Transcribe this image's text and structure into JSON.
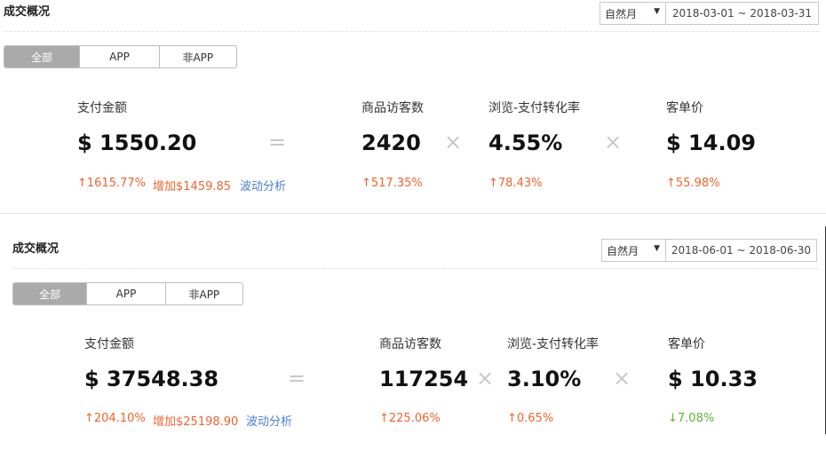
{
  "colors": {
    "increase": "#f0642a",
    "decrease": "#5cb531",
    "link": "#4a7fd3",
    "active_tab": "#aaaaaa"
  },
  "panels": [
    {
      "title": "成交概况",
      "period_select": "自然月",
      "date_range": "2018-03-01 ~ 2018-03-31",
      "tabs": [
        "全部",
        "APP",
        "非APP"
      ],
      "active_tab": "全部",
      "operators": {
        "equals": "=",
        "times": "×"
      },
      "metrics": {
        "pay_amount": {
          "label": "支付金额",
          "value": "$ 1550.20",
          "change": "↑1615.77%",
          "increase_text": "增加$1459.85",
          "analysis_link": "波动分析"
        },
        "visitors": {
          "label": "商品访客数",
          "value": "2420",
          "change": "↑517.35%"
        },
        "conversion": {
          "label": "浏览-支付转化率",
          "value": "4.55%",
          "change": "↑78.43%"
        },
        "unit_price": {
          "label": "客单价",
          "value": "$ 14.09",
          "change": "↑55.98%"
        }
      }
    },
    {
      "title": "成交概况",
      "period_select": "自然月",
      "date_range": "2018-06-01 ~ 2018-06-30",
      "tabs": [
        "全部",
        "APP",
        "非APP"
      ],
      "active_tab": "全部",
      "operators": {
        "equals": "=",
        "times": "×"
      },
      "metrics": {
        "pay_amount": {
          "label": "支付金额",
          "value": "$ 37548.38",
          "change": "↑204.10%",
          "increase_text": "增加$25198.90",
          "analysis_link": "波动分析"
        },
        "visitors": {
          "label": "商品访客数",
          "value": "117254",
          "change": "↑225.06%"
        },
        "conversion": {
          "label": "浏览-支付转化率",
          "value": "3.10%",
          "change": "↑0.65%"
        },
        "unit_price": {
          "label": "客单价",
          "value": "$ 10.33",
          "change": "↓7.08%"
        }
      }
    }
  ]
}
